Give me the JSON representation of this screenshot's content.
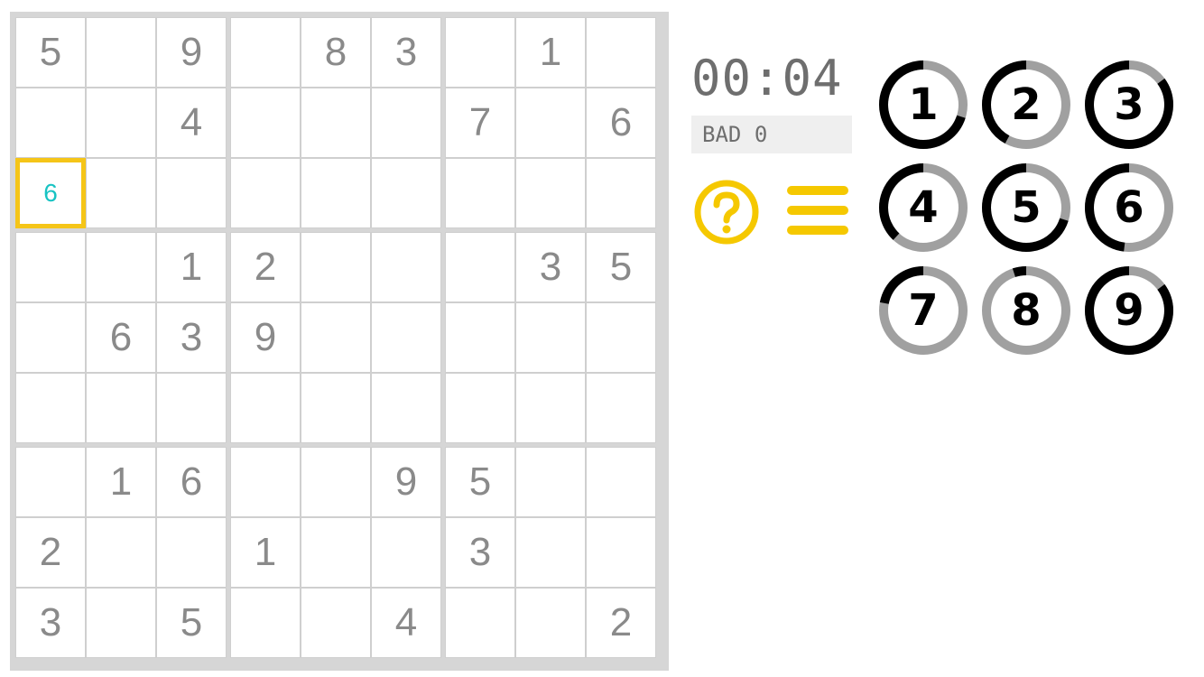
{
  "board": {
    "rows": [
      [
        "5",
        "",
        "9",
        "",
        "8",
        "3",
        "",
        "1",
        ""
      ],
      [
        "",
        "",
        "4",
        "",
        "",
        "",
        "7",
        "",
        "6"
      ],
      [
        "6",
        "",
        "",
        "",
        "",
        "",
        "",
        "",
        ""
      ],
      [
        "",
        "",
        "1",
        "2",
        "",
        "",
        "",
        "3",
        "5"
      ],
      [
        "",
        "6",
        "3",
        "9",
        "",
        "",
        "",
        "",
        ""
      ],
      [
        "",
        "",
        "",
        "",
        "",
        "",
        "",
        "",
        ""
      ],
      [
        "",
        "1",
        "6",
        "",
        "",
        "9",
        "5",
        "",
        ""
      ],
      [
        "2",
        "",
        "",
        "1",
        "",
        "",
        "3",
        "",
        ""
      ],
      [
        "3",
        "",
        "5",
        "",
        "",
        "4",
        "",
        "",
        "2"
      ]
    ],
    "selected": {
      "row": 2,
      "col": 0
    }
  },
  "status": {
    "timer": "00:04",
    "bad_label": "BAD",
    "bad_count": "0"
  },
  "controls": {
    "help_icon": "question-circle-icon",
    "menu_icon": "hamburger-menu-icon"
  },
  "number_pad": [
    {
      "label": "1",
      "progress": 0.3
    },
    {
      "label": "2",
      "progress": 0.58
    },
    {
      "label": "3",
      "progress": 0.15
    },
    {
      "label": "4",
      "progress": 0.62
    },
    {
      "label": "5",
      "progress": 0.3
    },
    {
      "label": "6",
      "progress": 0.52
    },
    {
      "label": "7",
      "progress": 0.78
    },
    {
      "label": "8",
      "progress": 0.95
    },
    {
      "label": "9",
      "progress": 0.15
    }
  ],
  "colors": {
    "accent": "#f5c800",
    "given_digit": "#8a8a8a",
    "entered_digit": "#18c3c3",
    "ring_filled": "#000000",
    "ring_empty": "#a0a0a0"
  }
}
